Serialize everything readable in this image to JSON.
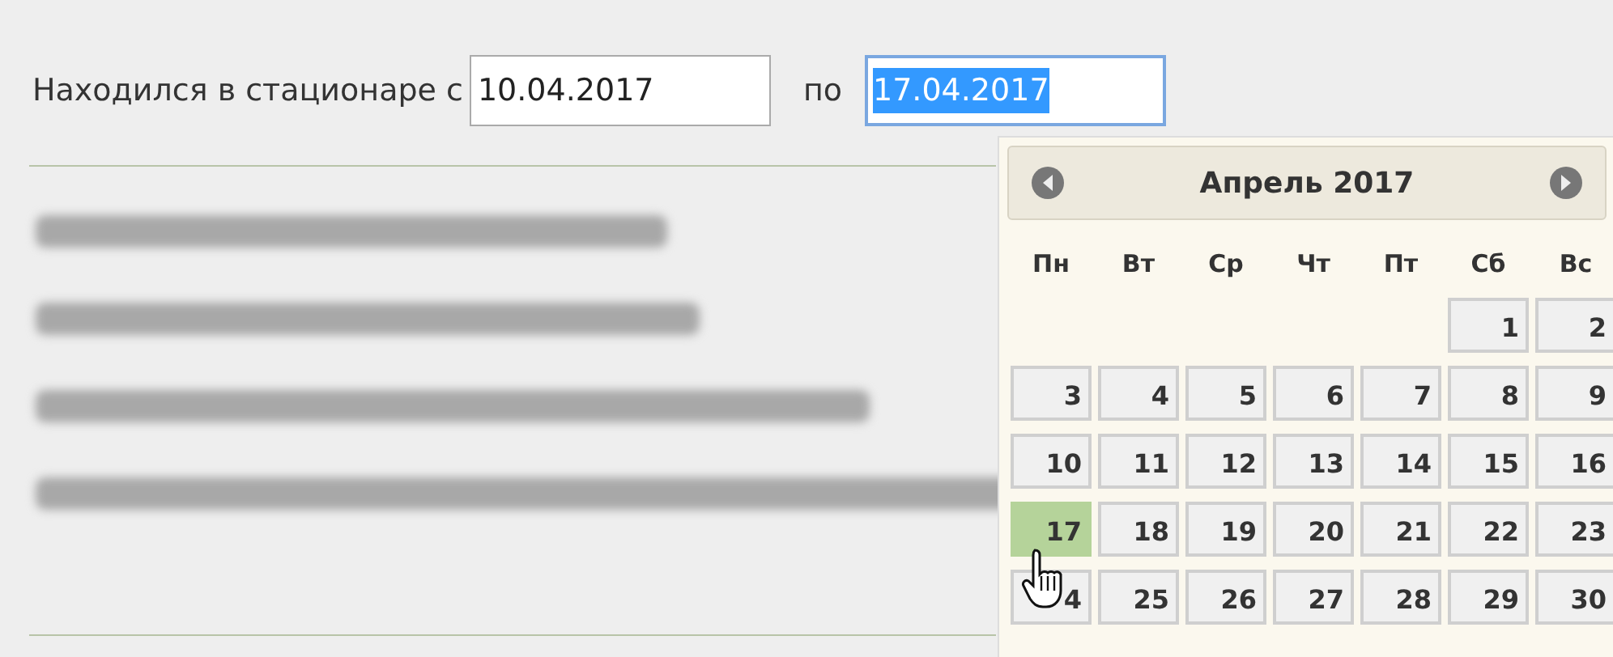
{
  "stay": {
    "label": "Находился в стационаре с",
    "from": {
      "value": "10.04.2017"
    },
    "to_label": "по",
    "to": {
      "value": "17.04.2017",
      "text_selected": true
    }
  },
  "calendar": {
    "title": "Апрель 2017",
    "weekdays": [
      "Пн",
      "Вт",
      "Ср",
      "Чт",
      "Пт",
      "Сб",
      "Вс"
    ],
    "days": [
      {
        "kind": "blank"
      },
      {
        "kind": "blank"
      },
      {
        "kind": "blank"
      },
      {
        "kind": "blank"
      },
      {
        "kind": "blank"
      },
      {
        "kind": "day",
        "label": "1",
        "selected": false
      },
      {
        "kind": "day",
        "label": "2",
        "selected": false
      },
      {
        "kind": "day",
        "label": "3",
        "selected": false
      },
      {
        "kind": "day",
        "label": "4",
        "selected": false
      },
      {
        "kind": "day",
        "label": "5",
        "selected": false
      },
      {
        "kind": "day",
        "label": "6",
        "selected": false
      },
      {
        "kind": "day",
        "label": "7",
        "selected": false
      },
      {
        "kind": "day",
        "label": "8",
        "selected": false
      },
      {
        "kind": "day",
        "label": "9",
        "selected": false
      },
      {
        "kind": "day",
        "label": "10",
        "selected": false
      },
      {
        "kind": "day",
        "label": "11",
        "selected": false
      },
      {
        "kind": "day",
        "label": "12",
        "selected": false
      },
      {
        "kind": "day",
        "label": "13",
        "selected": false
      },
      {
        "kind": "day",
        "label": "14",
        "selected": false
      },
      {
        "kind": "day",
        "label": "15",
        "selected": false
      },
      {
        "kind": "day",
        "label": "16",
        "selected": false
      },
      {
        "kind": "day",
        "label": "17",
        "selected": true
      },
      {
        "kind": "day",
        "label": "18",
        "selected": false
      },
      {
        "kind": "day",
        "label": "19",
        "selected": false
      },
      {
        "kind": "day",
        "label": "20",
        "selected": false
      },
      {
        "kind": "day",
        "label": "21",
        "selected": false
      },
      {
        "kind": "day",
        "label": "22",
        "selected": false
      },
      {
        "kind": "day",
        "label": "23",
        "selected": false
      },
      {
        "kind": "day",
        "label": "4",
        "selected": false,
        "under_cursor": true
      },
      {
        "kind": "day",
        "label": "25",
        "selected": false
      },
      {
        "kind": "day",
        "label": "26",
        "selected": false
      },
      {
        "kind": "day",
        "label": "27",
        "selected": false
      },
      {
        "kind": "day",
        "label": "28",
        "selected": false
      },
      {
        "kind": "day",
        "label": "29",
        "selected": false
      },
      {
        "kind": "day",
        "label": "30",
        "selected": false
      }
    ]
  }
}
